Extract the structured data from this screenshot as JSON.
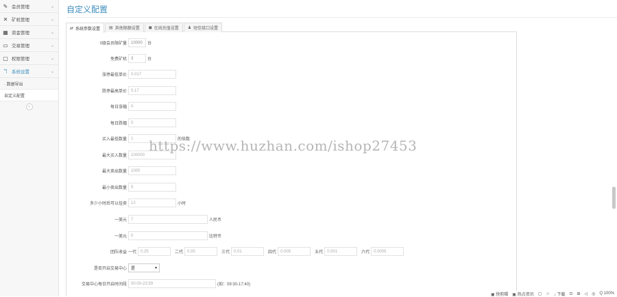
{
  "sidebar": {
    "items": [
      {
        "icon": "✎",
        "label": "会员管理"
      },
      {
        "icon": "✕",
        "label": "矿机管理"
      },
      {
        "icon": "▦",
        "label": "资金管理"
      },
      {
        "icon": "▭",
        "label": "交易管理"
      },
      {
        "icon": "▢",
        "label": "权限管理"
      },
      {
        "icon": "ℸ",
        "label": "系统设置"
      }
    ],
    "sub_items": [
      {
        "label": "· 数据导出"
      },
      {
        "label": "自定义配置"
      }
    ],
    "collapse_glyph": "«"
  },
  "page": {
    "title": "自定义配置"
  },
  "tabs": [
    {
      "icon": "⇄",
      "label": "系统参数设置"
    },
    {
      "icon": "▤",
      "label": "其他限额设置"
    },
    {
      "icon": "◼",
      "label": "在线充值设置"
    },
    {
      "icon": "♟",
      "label": "短信接口设置"
    }
  ],
  "form": {
    "f1": {
      "label": "0级会员限矿量",
      "value": "10000",
      "unit": "台"
    },
    "f2": {
      "label": "免费矿机",
      "value": "3",
      "unit": "台"
    },
    "f3": {
      "label": "涨停最低单价",
      "value": "0.017"
    },
    "f4": {
      "label": "跌停最高单价",
      "value": "0.17"
    },
    "f5": {
      "label": "每日涨幅",
      "value": "0"
    },
    "f6": {
      "label": "每日跌幅",
      "value": "0"
    },
    "f7": {
      "label": "买入最低数量",
      "value": "1",
      "unit": "的倍数"
    },
    "f8": {
      "label": "最大买入数量",
      "value": "100000"
    },
    "f9": {
      "label": "最大卖出数量",
      "value": "1000"
    },
    "f10": {
      "label": "最小卖出数量",
      "value": "5"
    },
    "f11": {
      "label": "多少小时后可以挂卖",
      "value": "12",
      "unit": "小时"
    },
    "f12": {
      "label": "一美元",
      "value": "7",
      "unit": "人民币"
    },
    "f13": {
      "label": "一美元",
      "value": "0",
      "unit": "比特币"
    },
    "f14": {
      "label": "团队收益",
      "gens": [
        {
          "label": "一代",
          "value": "0.25"
        },
        {
          "label": "二代",
          "value": "0.05"
        },
        {
          "label": "三代",
          "value": "0.01"
        },
        {
          "label": "四代",
          "value": "0.005"
        },
        {
          "label": "五代",
          "value": "0.001"
        },
        {
          "label": "六代",
          "value": "0.0005"
        }
      ]
    },
    "f15": {
      "label": "是否开启交易中心",
      "selected": "是",
      "arrow": "▾"
    },
    "f16": {
      "label": "交易中心每日开启时间段",
      "value": "00:00-23:59",
      "hint": "(如：09:30-17:40)"
    }
  },
  "watermark": "https://www.huzhan.com/ishop27453",
  "statusbar": {
    "items": [
      "▣ 快剪辑",
      "▣ 热点资讯",
      "▢",
      "☆",
      "↓ 下载",
      "⊡",
      "⊞",
      "◁",
      "◎",
      "Q 100%"
    ]
  }
}
